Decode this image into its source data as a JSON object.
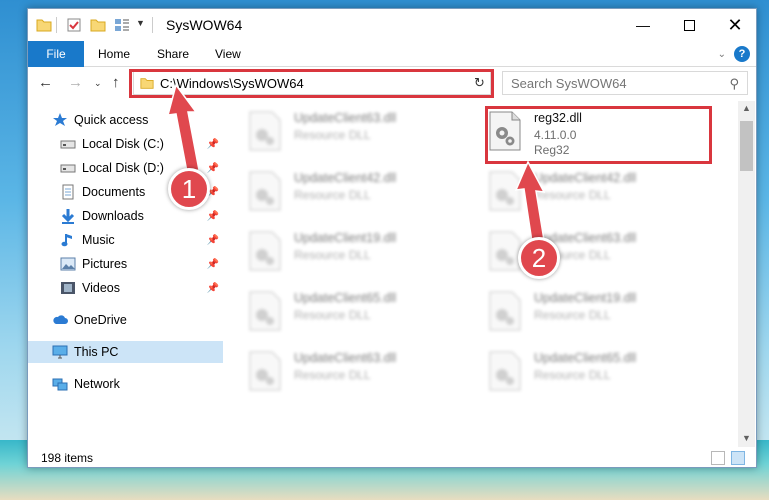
{
  "window": {
    "title": "SysWOW64",
    "minimize_icon": "minimize-icon",
    "maximize_icon": "maximize-icon",
    "close_icon": "close-icon"
  },
  "ribbon": {
    "tabs": [
      "File",
      "Home",
      "Share",
      "View"
    ]
  },
  "address_bar": {
    "path": "C:\\Windows\\SysWOW64"
  },
  "search": {
    "placeholder": "Search SysWOW64"
  },
  "sidebar": {
    "items": [
      {
        "label": "Quick access",
        "icon": "star-icon"
      },
      {
        "label": "Local Disk (C:)",
        "icon": "drive-icon",
        "pinned": true
      },
      {
        "label": "Local Disk (D:)",
        "icon": "drive-icon",
        "pinned": true
      },
      {
        "label": "Documents",
        "icon": "documents-icon",
        "pinned": true
      },
      {
        "label": "Downloads",
        "icon": "download-icon",
        "pinned": true
      },
      {
        "label": "Music",
        "icon": "music-icon",
        "pinned": true
      },
      {
        "label": "Pictures",
        "icon": "pictures-icon",
        "pinned": true
      },
      {
        "label": "Videos",
        "icon": "videos-icon",
        "pinned": true
      },
      {
        "label": "OneDrive",
        "icon": "cloud-icon"
      },
      {
        "label": "This PC",
        "icon": "computer-icon",
        "selected": true
      },
      {
        "label": "Network",
        "icon": "network-icon"
      }
    ]
  },
  "files": {
    "left": [
      {
        "name": "UpdateClient63.dll",
        "type": "Resource DLL"
      },
      {
        "name": "UpdateClient42.dll",
        "type": "Resource DLL"
      },
      {
        "name": "UpdateClient19.dll",
        "type": "Resource DLL"
      },
      {
        "name": "UpdateClient65.dll",
        "type": "Resource DLL"
      },
      {
        "name": "UpdateClient63.dll",
        "type": "Resource DLL"
      }
    ],
    "right": [
      {
        "name": "reg32.dll",
        "version": "4.11.0.0",
        "type": "Reg32"
      },
      {
        "name": "UpdateClient42.dll",
        "type": "Resource DLL"
      },
      {
        "name": "UpdateClient63.dll",
        "type": "Resource DLL"
      },
      {
        "name": "UpdateClient19.dll",
        "type": "Resource DLL"
      },
      {
        "name": "UpdateClient65.dll",
        "type": "Resource DLL"
      }
    ]
  },
  "status": {
    "item_count": "198 items"
  },
  "annotations": {
    "step1": "1",
    "step2": "2",
    "color": "#e0484e"
  }
}
